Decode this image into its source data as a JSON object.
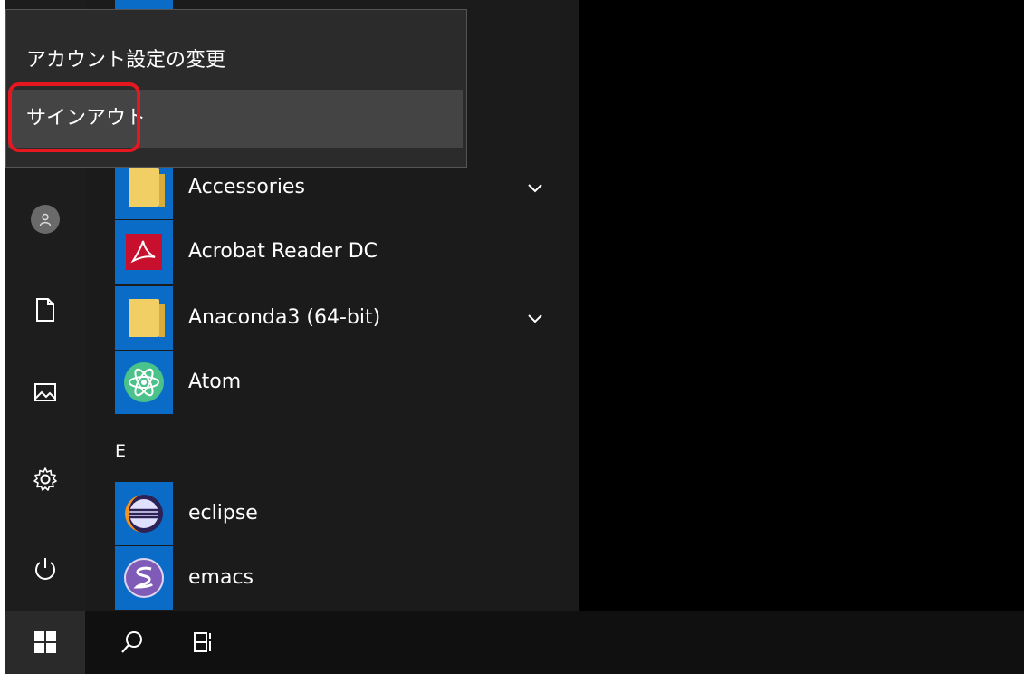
{
  "account_menu": {
    "change_settings": "アカウント設定の変更",
    "sign_out": "サインアウト"
  },
  "rail": {
    "icons": [
      "user-avatar",
      "document-icon",
      "pictures-icon",
      "settings-gear-icon",
      "power-icon"
    ]
  },
  "app_list": {
    "section_letter": "E",
    "apps": [
      {
        "label": "Accessories",
        "expandable": true
      },
      {
        "label": "Acrobat Reader DC",
        "expandable": false
      },
      {
        "label": "Anaconda3 (64-bit)",
        "expandable": true
      },
      {
        "label": "Atom",
        "expandable": false
      },
      {
        "label": "eclipse",
        "expandable": false
      },
      {
        "label": "emacs",
        "expandable": false
      }
    ]
  },
  "taskbar": {
    "icons": [
      "windows-start-icon",
      "search-icon",
      "task-view-icon"
    ]
  },
  "colors": {
    "tile_blue": "#0a6cc6",
    "highlight_red": "#e5171f",
    "menu_bg": "#1b1b1b"
  }
}
